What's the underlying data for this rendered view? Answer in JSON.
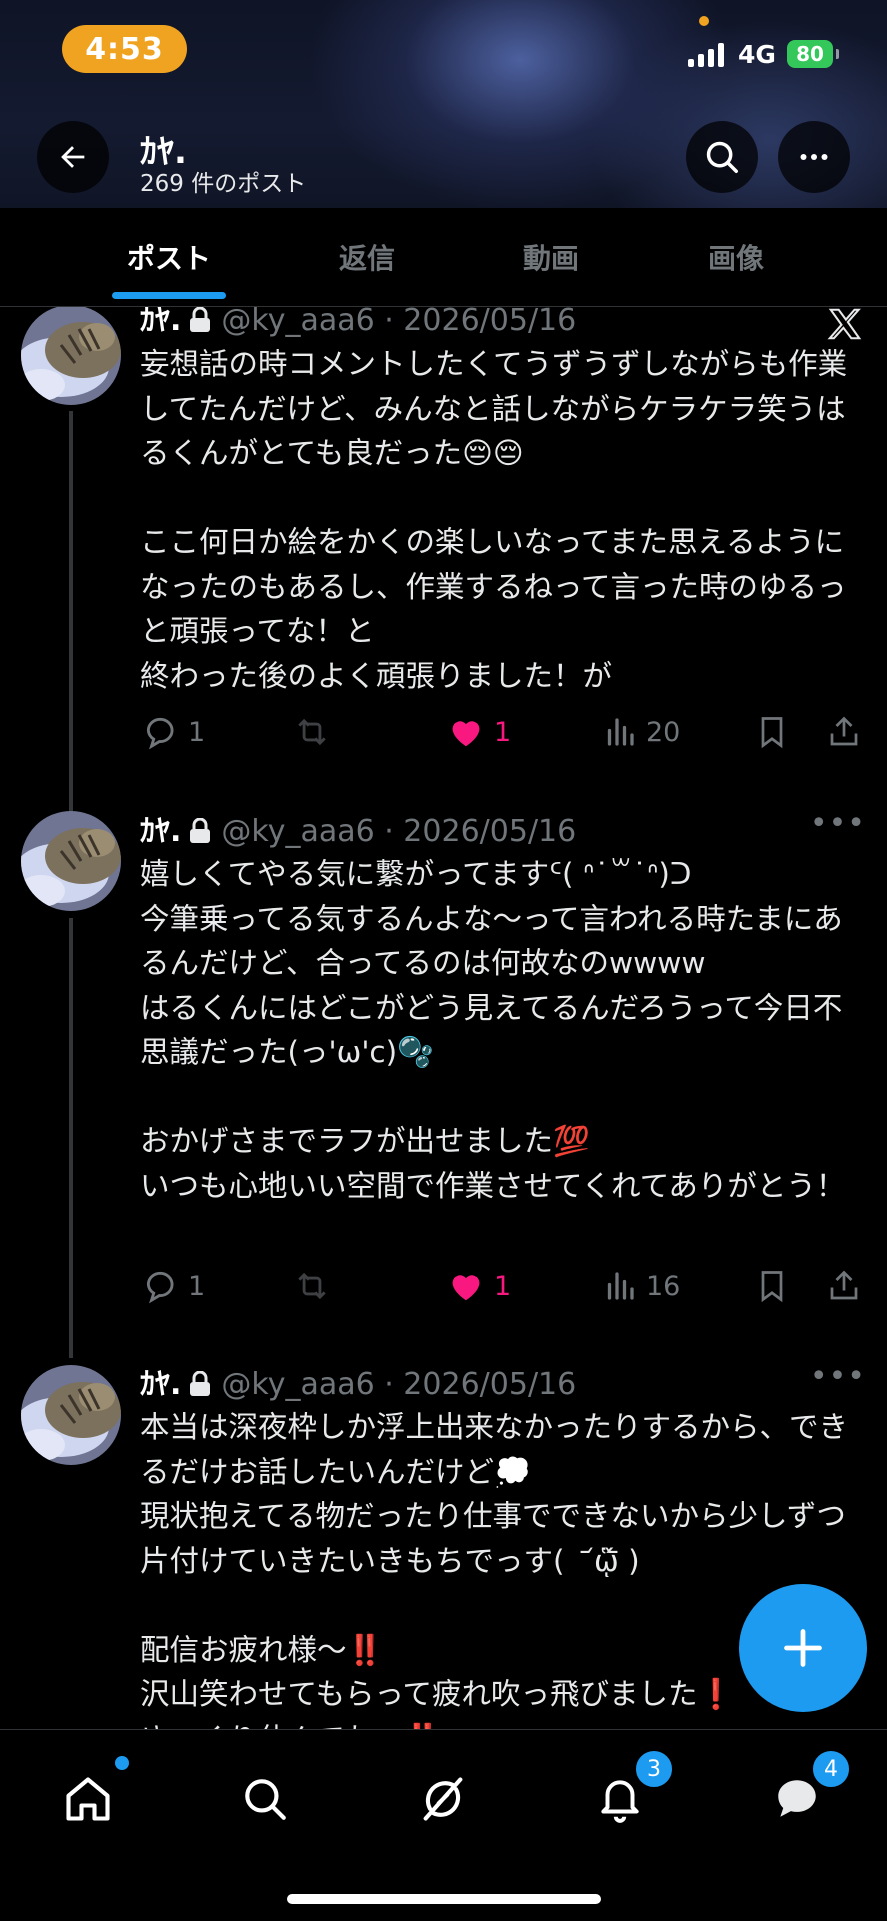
{
  "status_bar": {
    "time": "4:53",
    "network": "4G",
    "battery": "80"
  },
  "header": {
    "title": "ｶﾔ.",
    "subtitle": "269 件のポスト"
  },
  "tabs": [
    {
      "label": "ポスト",
      "active": true
    },
    {
      "label": "返信",
      "active": false
    },
    {
      "label": "動画",
      "active": false
    },
    {
      "label": "画像",
      "active": false
    }
  ],
  "posts": [
    {
      "name": "ｶﾔ.",
      "meta": "@ky_aaa6 · 2026/05/16",
      "text": "妄想話の時コメントしたくてうずうずしながらも作業してたんだけど、みんなと話しながらケラケラ笑うはるくんがとても良だった😔😔\n\nここ何日か絵をかくの楽しいなってまた思えるようになったのもあるし、作業するねって言った時のゆるっと頑張ってな！と\n終わった後のよく頑張りました！が",
      "replies": "1",
      "likes": "1",
      "views": "20"
    },
    {
      "name": "ｶﾔ.",
      "meta": "@ky_aaa6 · 2026/05/16",
      "text": "嬉しくてやる気に繋がってますᑦ( ᐢ˙꒳˙ᐢ)ᑐ\n今筆乗ってる気するんよな〜って言われる時たまにあるんだけど、合ってるのは何故なのwwww\nはるくんにはどこがどう見えてるんだろうって今日不思議だった(っ'ω'c)🫧\n\nおかげさまでラフが出せました💯\nいつも心地いい空間で作業させてくれてありがとう！",
      "replies": "1",
      "likes": "1",
      "views": "16"
    },
    {
      "name": "ｶﾔ.",
      "meta": "@ky_aaa6 · 2026/05/16",
      "text": "本当は深夜枠しか浮上出来なかったりするから、できるだけお話したいんだけど💭\n現状抱えてる物だったり仕事でできないから少しずつ片付けていきたいきもちでっす(　᷄ᾥ᷅ )\n\n配信お疲れ様〜‼️\n沢山笑わせてもらって疲れ吹っ飛びました❗️\nゆっくり休んでね〜‼️"
    }
  ],
  "nav": {
    "notifications_badge": "3",
    "messages_badge": "4"
  },
  "colors": {
    "accent": "#1d9bf0",
    "like": "#f91880",
    "muted": "#71767b",
    "status_pill": "#f0a320",
    "battery": "#34c759"
  },
  "icons": [
    "back-arrow-icon",
    "search-icon",
    "more-icon",
    "x-logo-icon",
    "lock-icon",
    "reply-icon",
    "repost-icon",
    "heart-icon",
    "views-icon",
    "bookmark-icon",
    "share-icon",
    "compose-plus-icon",
    "home-icon",
    "explore-icon",
    "grok-icon",
    "bell-icon",
    "messages-icon"
  ]
}
